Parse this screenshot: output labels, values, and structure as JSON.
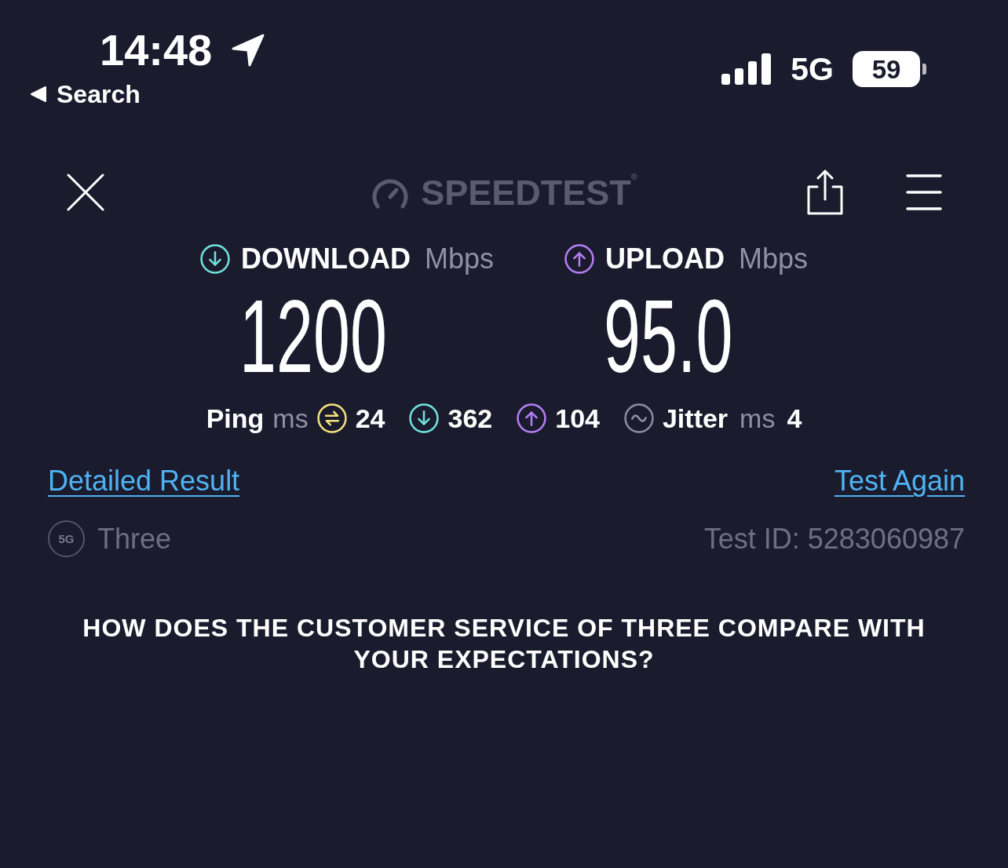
{
  "status_bar": {
    "time": "14:48",
    "back_label": "Search",
    "network": "5G",
    "battery": "59"
  },
  "header": {
    "logo": "SPEEDTEST$^{®}$"
  },
  "results": [
    {
      "kind": "download",
      "label": "DOWNLOAD",
      "unit": "Mbps",
      "value": "1200",
      "color": "#6fe3dc"
    },
    {
      "kind": "upload",
      "label": "UPLOAD",
      "unit": "Mbps",
      "value": "95.0",
      "color": "#b57ef5"
    }
  ],
  "ping": {
    "label": "Ping",
    "unit": "ms",
    "items": [
      {
        "kind": "idle",
        "value": "24",
        "color": "#f3e27d"
      },
      {
        "kind": "download",
        "value": "362",
        "color": "#6fe3dc"
      },
      {
        "kind": "upload",
        "value": "104",
        "color": "#b57ef5"
      }
    ]
  },
  "jitter": {
    "label": "Jitter",
    "unit": "ms",
    "value": "4",
    "color": "#8c8c9c"
  },
  "links": [
    {
      "label": "Detailed Result"
    },
    {
      "label": "Test Again"
    }
  ],
  "provider": {
    "badge": "5G",
    "name": "Three",
    "test_id": "Test ID: 5283060987"
  },
  "question": "HOW DOES THE CUSTOMER SERVICE OF THREE COMPARE WITH YOUR EXPECTATIONS?"
}
